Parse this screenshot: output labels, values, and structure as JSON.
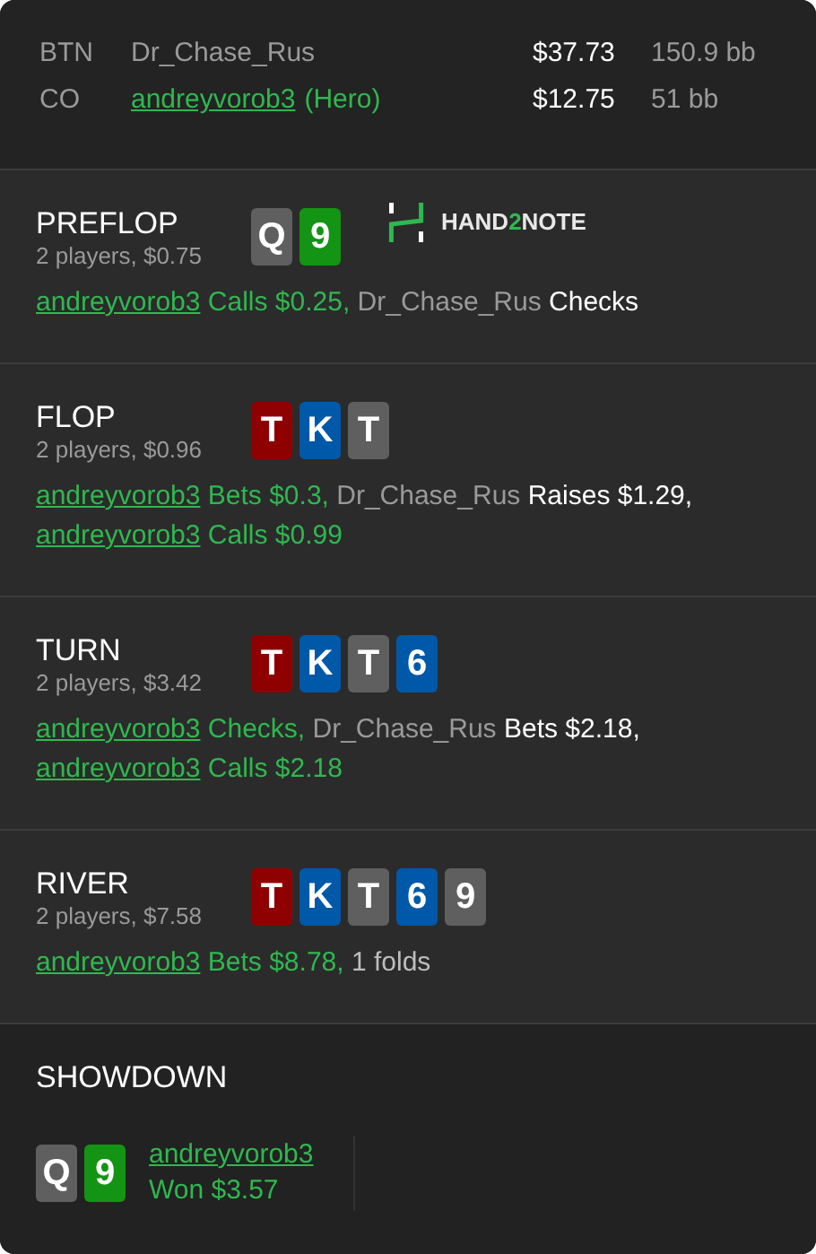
{
  "players": [
    {
      "position": "BTN",
      "name": "Dr_Chase_Rus",
      "hero": false,
      "stack": "$37.73",
      "bb": "150.9 bb"
    },
    {
      "position": "CO",
      "name": "andreyvorob3",
      "hero": true,
      "hero_tag": "(Hero)",
      "stack": "$12.75",
      "bb": "51 bb"
    }
  ],
  "streets": [
    {
      "title": "PREFLOP",
      "info": "2 players, $0.75",
      "cards": [
        {
          "rank": "Q",
          "color": "#5f5f5f"
        },
        {
          "rank": "9",
          "color": "#149414"
        }
      ],
      "logo": {
        "parts": [
          {
            "text": "HAND",
            "accent": false
          },
          {
            "text": "2",
            "accent": true
          },
          {
            "text": "NOTE",
            "accent": false
          }
        ]
      },
      "actions": [
        {
          "kind": "hero",
          "player": "andreyvorob3",
          "text": "Calls $0.25,"
        },
        {
          "kind": "villain",
          "player": "Dr_Chase_Rus",
          "text": "Checks"
        }
      ]
    },
    {
      "title": "FLOP",
      "info": "2 players, $0.96",
      "cards": [
        {
          "rank": "T",
          "color": "#8f0000"
        },
        {
          "rank": "K",
          "color": "#0058a8"
        },
        {
          "rank": "T",
          "color": "#5f5f5f"
        }
      ],
      "actions": [
        {
          "kind": "hero",
          "player": "andreyvorob3",
          "text": "Bets $0.3,"
        },
        {
          "kind": "villain",
          "player": "Dr_Chase_Rus",
          "text": "Raises $1.29,"
        },
        {
          "kind": "hero",
          "player": "andreyvorob3",
          "text": "Calls $0.99"
        }
      ]
    },
    {
      "title": "TURN",
      "info": "2 players, $3.42",
      "cards": [
        {
          "rank": "T",
          "color": "#8f0000"
        },
        {
          "rank": "K",
          "color": "#0058a8"
        },
        {
          "rank": "T",
          "color": "#5f5f5f"
        },
        {
          "rank": "6",
          "color": "#0058a8"
        }
      ],
      "actions": [
        {
          "kind": "hero",
          "player": "andreyvorob3",
          "text": "Checks,"
        },
        {
          "kind": "villain",
          "player": "Dr_Chase_Rus",
          "text": "Bets $2.18,"
        },
        {
          "kind": "hero",
          "player": "andreyvorob3",
          "text": "Calls $2.18"
        }
      ]
    },
    {
      "title": "RIVER",
      "info": "2 players, $7.58",
      "cards": [
        {
          "rank": "T",
          "color": "#8f0000"
        },
        {
          "rank": "K",
          "color": "#0058a8"
        },
        {
          "rank": "T",
          "color": "#5f5f5f"
        },
        {
          "rank": "6",
          "color": "#0058a8"
        },
        {
          "rank": "9",
          "color": "#5f5f5f"
        }
      ],
      "actions": [
        {
          "kind": "hero",
          "player": "andreyvorob3",
          "text": "Bets $8.78,"
        },
        {
          "kind": "summary",
          "text": "1 folds"
        }
      ]
    }
  ],
  "showdown": {
    "title": "SHOWDOWN",
    "cards": [
      {
        "rank": "Q",
        "color": "#5f5f5f"
      },
      {
        "rank": "9",
        "color": "#149414"
      }
    ],
    "player": "andreyvorob3",
    "result": "Won $3.57"
  }
}
